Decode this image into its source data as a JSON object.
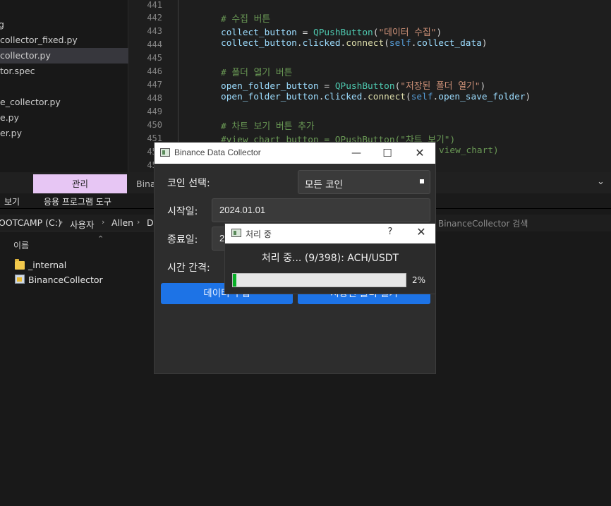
{
  "editor": {
    "explorer_files": [
      "g",
      "collector_fixed.py",
      "collector.py",
      "tor.spec",
      "e_collector.py",
      "e.py",
      "er.py"
    ],
    "active_file": "collector.py",
    "line_numbers": [
      "441",
      "442",
      "443",
      "444",
      "445",
      "446",
      "447",
      "448",
      "449",
      "450",
      "451",
      "452",
      "453"
    ],
    "code": {
      "l442": "# 수집 버튼",
      "l443_var": "collect_button",
      "l443_cls": "QPushButton",
      "l443_str": "\"데이터 수집\"",
      "l444_obj": "collect_button",
      "l444_attr": "clicked",
      "l444_fn": "connect",
      "l444_self": "self",
      "l444_arg": "collect_data",
      "l446": "# 폴더 열기 버튼",
      "l447_var": "open_folder_button",
      "l447_cls": "QPushButton",
      "l447_str": "\"저장된 폴더 열기\"",
      "l448_obj": "open_folder_button",
      "l448_attr": "clicked",
      "l448_fn": "connect",
      "l448_self": "self",
      "l448_arg": "open_save_folder",
      "l450": "# 차트 보기 버튼 추가",
      "l451": "#view_chart_button = QPushButton(\"차트 보기\")",
      "l452": "view_chart)"
    }
  },
  "file_explorer": {
    "manage_tab": "관리",
    "title_partial": "Binar",
    "ribbon_view": "보기",
    "ribbon_app_tools": "응용 프로그램 도구",
    "breadcrumbs": [
      "OOTCAMP (C:)",
      "사용자",
      "Allen",
      "De"
    ],
    "search_placeholder": "BinanceCollector 검색",
    "column_name": "이름",
    "items": [
      "_internal",
      "BinanceCollector"
    ]
  },
  "app_window": {
    "title": "Binance Data Collector",
    "coin_label": "코인 선택:",
    "coin_value": "모든 코인",
    "start_label": "시작일:",
    "start_value": "2024.01.01",
    "end_label": "종료일:",
    "end_value": "2",
    "interval_label": "시간 간격:",
    "collect_button": "데이터 수집",
    "open_folder_button": "저장된 폴더 열기"
  },
  "progress_dialog": {
    "title": "처리 중",
    "help": "?",
    "status": "처리 중... (9/398): ACH/USDT",
    "progress_value": 0.02,
    "percent_text": "2%",
    "bar_color": "#06b025"
  },
  "colors": {
    "accent_button": "#1d73e6",
    "manage_tab": "#e7c6f4"
  }
}
